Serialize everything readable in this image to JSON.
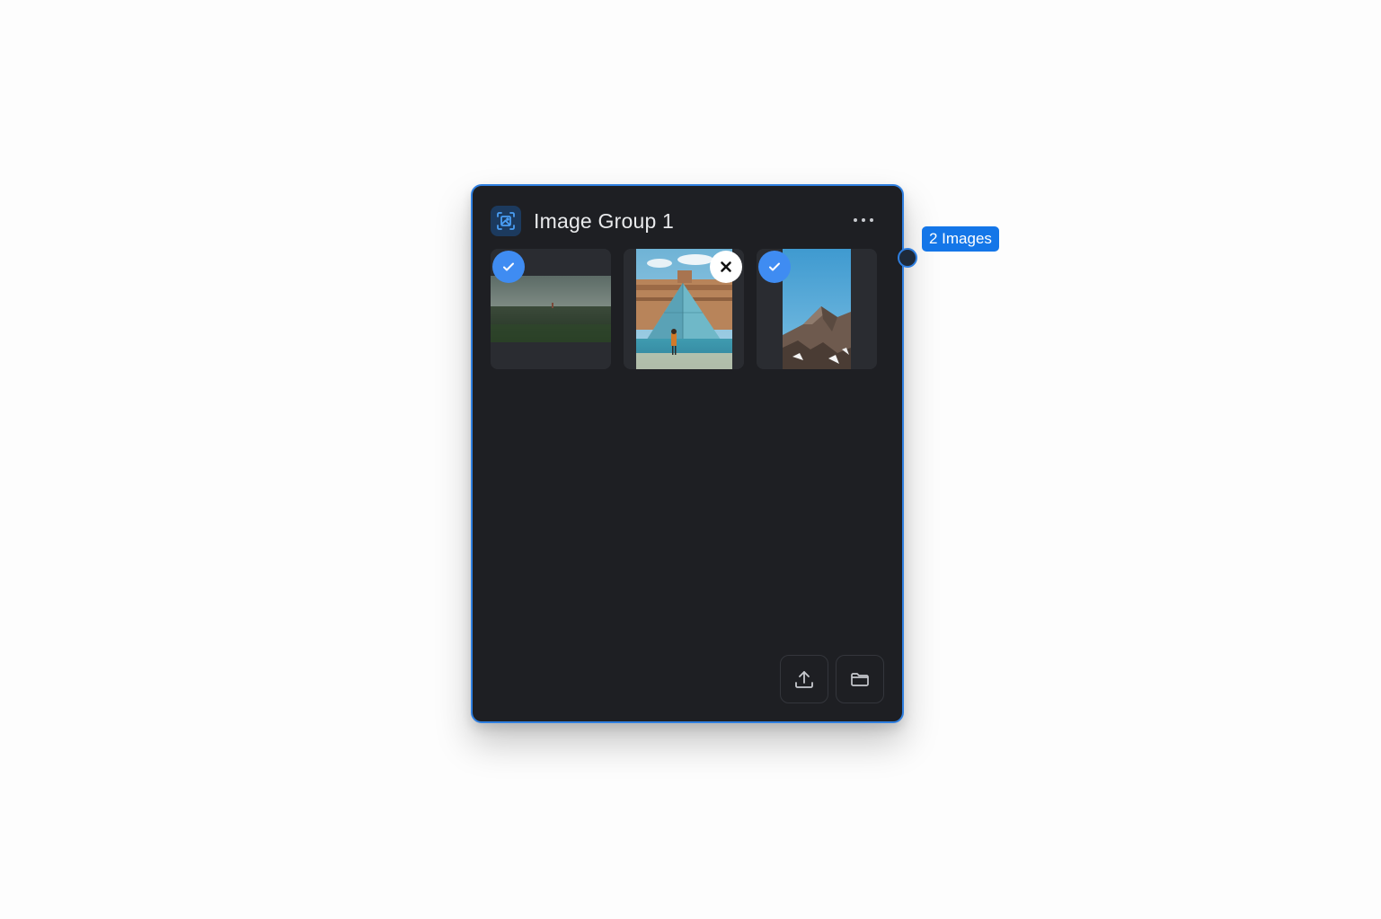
{
  "node": {
    "title": "Image Group 1",
    "icon": "image-group-icon",
    "menu_icon": "more-horizontal-icon",
    "accent_color": "#2f7fe0",
    "background_color": "#1e1f23"
  },
  "images": [
    {
      "name": "field-landscape",
      "state": "selected",
      "badge_icon": "check-icon"
    },
    {
      "name": "louvre-pyramid",
      "state": "removable",
      "badge_icon": "close-icon"
    },
    {
      "name": "mountain-sky",
      "state": "selected",
      "badge_icon": "check-icon"
    }
  ],
  "footer": {
    "upload_icon": "upload-icon",
    "folder_icon": "folder-icon"
  },
  "output": {
    "label": "2 Images",
    "label_color": "#1476e8"
  }
}
